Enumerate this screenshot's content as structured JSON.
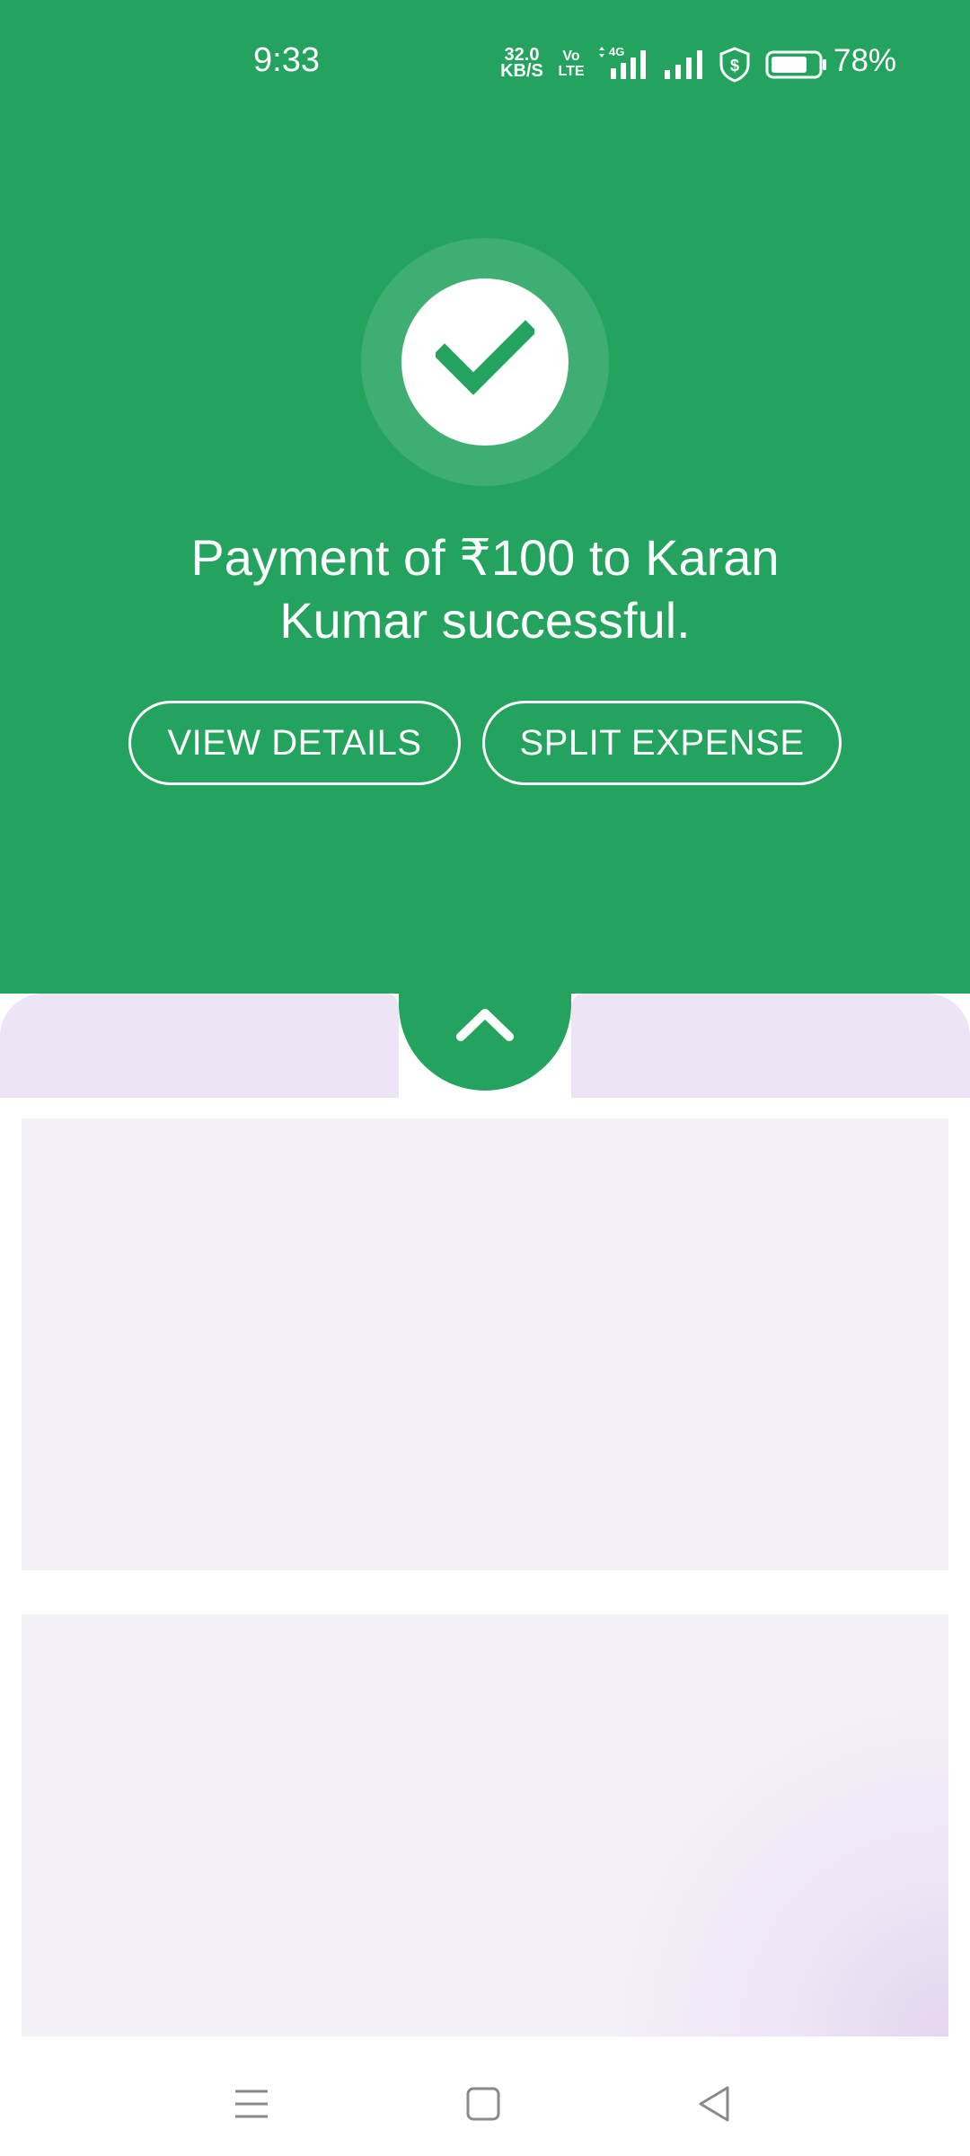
{
  "status_bar": {
    "time": "9:33",
    "net_speed_value": "32.0",
    "net_speed_unit": "KB/S",
    "volte_top": "Vo",
    "volte_bottom": "LTE",
    "network_type": "4G",
    "battery_percent": "78%",
    "battery_level": 0.78
  },
  "payment": {
    "message": "Payment of ₹100 to Karan Kumar successful.",
    "status_icon": "check-icon"
  },
  "actions": {
    "view_details_label": "VIEW DETAILS",
    "split_expense_label": "SPLIT EXPENSE"
  },
  "sheet": {
    "handle_icon": "chevron-up-icon"
  },
  "nav": {
    "menu_icon": "menu-icon",
    "home_icon": "home-icon",
    "back_icon": "back-icon"
  },
  "colors": {
    "primary_green": "#23a35d",
    "sheet_lavender": "#ede4f6",
    "skeleton_card": "#f4f0f8",
    "nav_icon_gray": "#8a8a8a"
  }
}
